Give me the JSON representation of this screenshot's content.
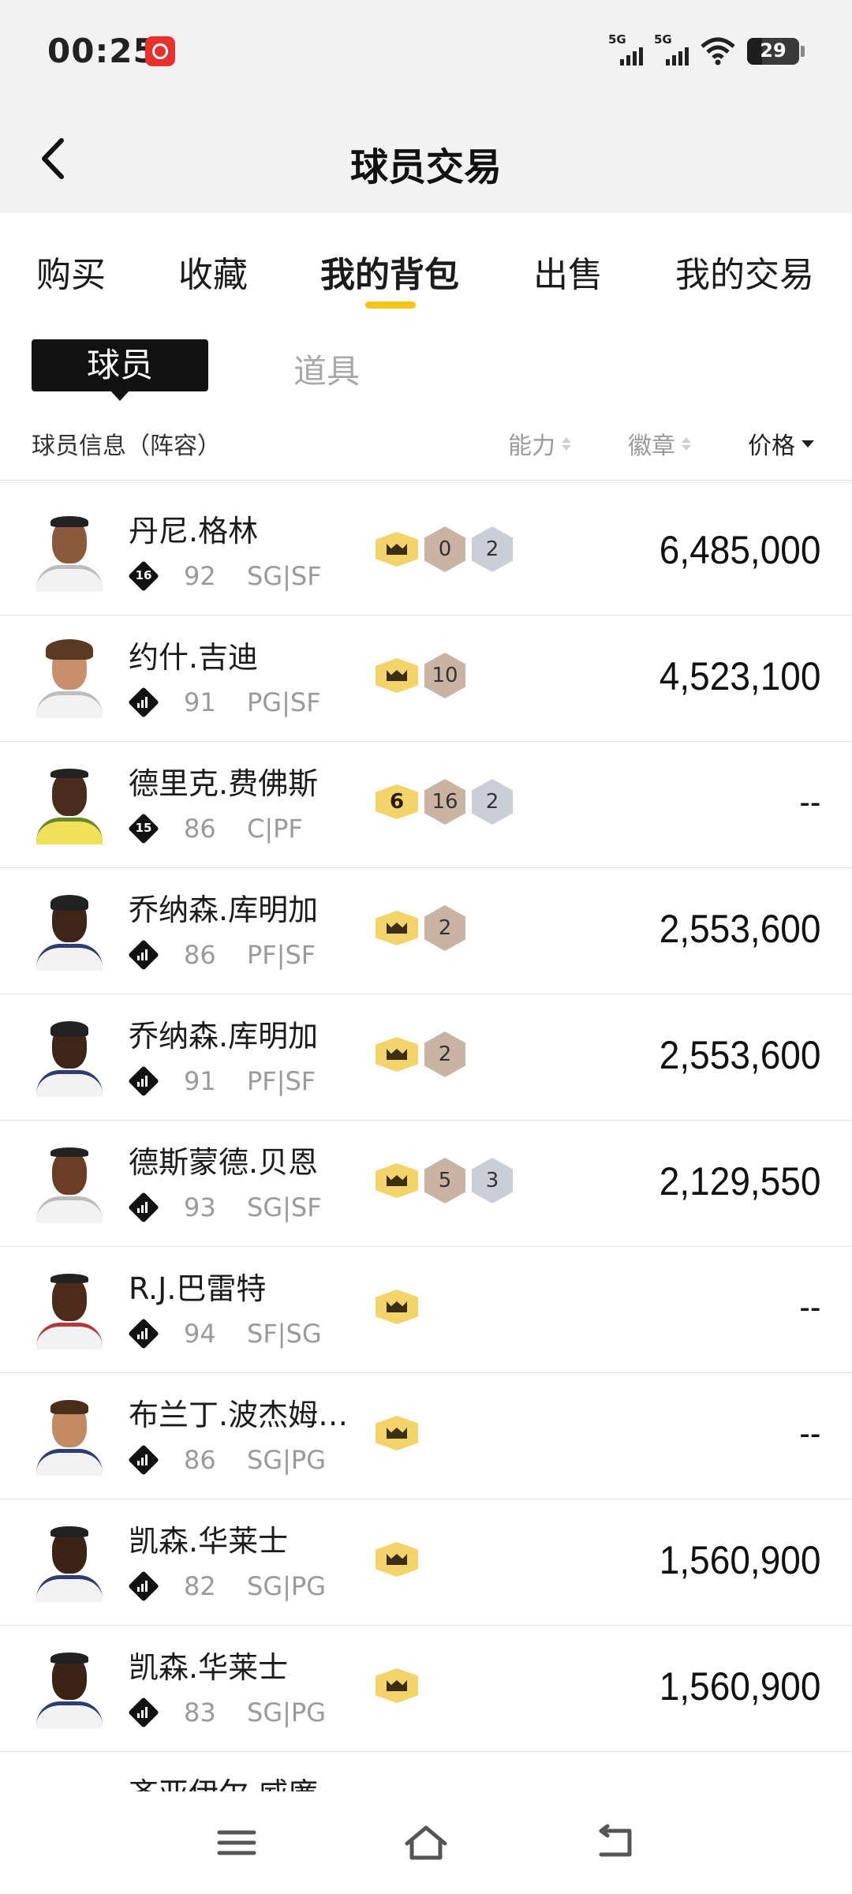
{
  "status_bar": {
    "time": "00:25",
    "network_1": "5G",
    "network_2": "5G",
    "battery": "29"
  },
  "header": {
    "title": "球员交易"
  },
  "tabs": [
    {
      "label": "购买"
    },
    {
      "label": "收藏"
    },
    {
      "label": "我的背包"
    },
    {
      "label": "出售"
    },
    {
      "label": "我的交易"
    }
  ],
  "segments": {
    "active": "球员",
    "inactive": "道具"
  },
  "columns": {
    "info": "球员信息（阵容）",
    "ability": "能力",
    "badge": "徽章",
    "price": "价格"
  },
  "players": [
    {
      "name": "丹尼.格林",
      "rank": "16",
      "rating": "92",
      "position": "SG|SF",
      "price": "6,485,000"
    },
    {
      "name": "约什.吉迪",
      "rank": "",
      "rating": "91",
      "position": "PG|SF",
      "price": "4,523,100"
    },
    {
      "name": "德里克.费佛斯",
      "rank": "15",
      "rating": "86",
      "position": "C|PF",
      "price": "--"
    },
    {
      "name": "乔纳森.库明加",
      "rank": "",
      "rating": "86",
      "position": "PF|SF",
      "price": "2,553,600"
    },
    {
      "name": "乔纳森.库明加",
      "rank": "",
      "rating": "91",
      "position": "PF|SF",
      "price": "2,553,600"
    },
    {
      "name": "德斯蒙德.贝恩",
      "rank": "",
      "rating": "93",
      "position": "SG|SF",
      "price": "2,129,550"
    },
    {
      "name": "R.J.巴雷特",
      "rank": "",
      "rating": "94",
      "position": "SF|SG",
      "price": "--"
    },
    {
      "name": "布兰丁.波杰姆…",
      "rank": "",
      "rating": "86",
      "position": "SG|PG",
      "price": "--"
    },
    {
      "name": "凯森.华莱士",
      "rank": "",
      "rating": "82",
      "position": "SG|PG",
      "price": "1,560,900"
    },
    {
      "name": "凯森.华莱士",
      "rank": "",
      "rating": "83",
      "position": "SG|PG",
      "price": "1,560,900"
    },
    {
      "name": "齐亚伊尔.威廉…"
    }
  ],
  "badges": {
    "row0": {
      "bronze": "0",
      "silver": "2"
    },
    "row1": {
      "bronze": "10"
    },
    "row2": {
      "gold": "6",
      "bronze": "16",
      "silver": "2"
    },
    "row3": {
      "bronze": "2"
    },
    "row4": {
      "bronze": "2"
    },
    "row5": {
      "bronze": "5",
      "silver": "3"
    }
  },
  "colors": {
    "accent": "#f5c518",
    "badge_gold": "#f3d46a",
    "badge_bronze": "#cbb3a4",
    "badge_silver": "#c9ced9",
    "header_bg": "#f2f2f2"
  },
  "icons": {
    "back": "chevron-left-icon",
    "menu": "menu-icon",
    "home": "home-icon",
    "return": "back-arrow-icon"
  }
}
